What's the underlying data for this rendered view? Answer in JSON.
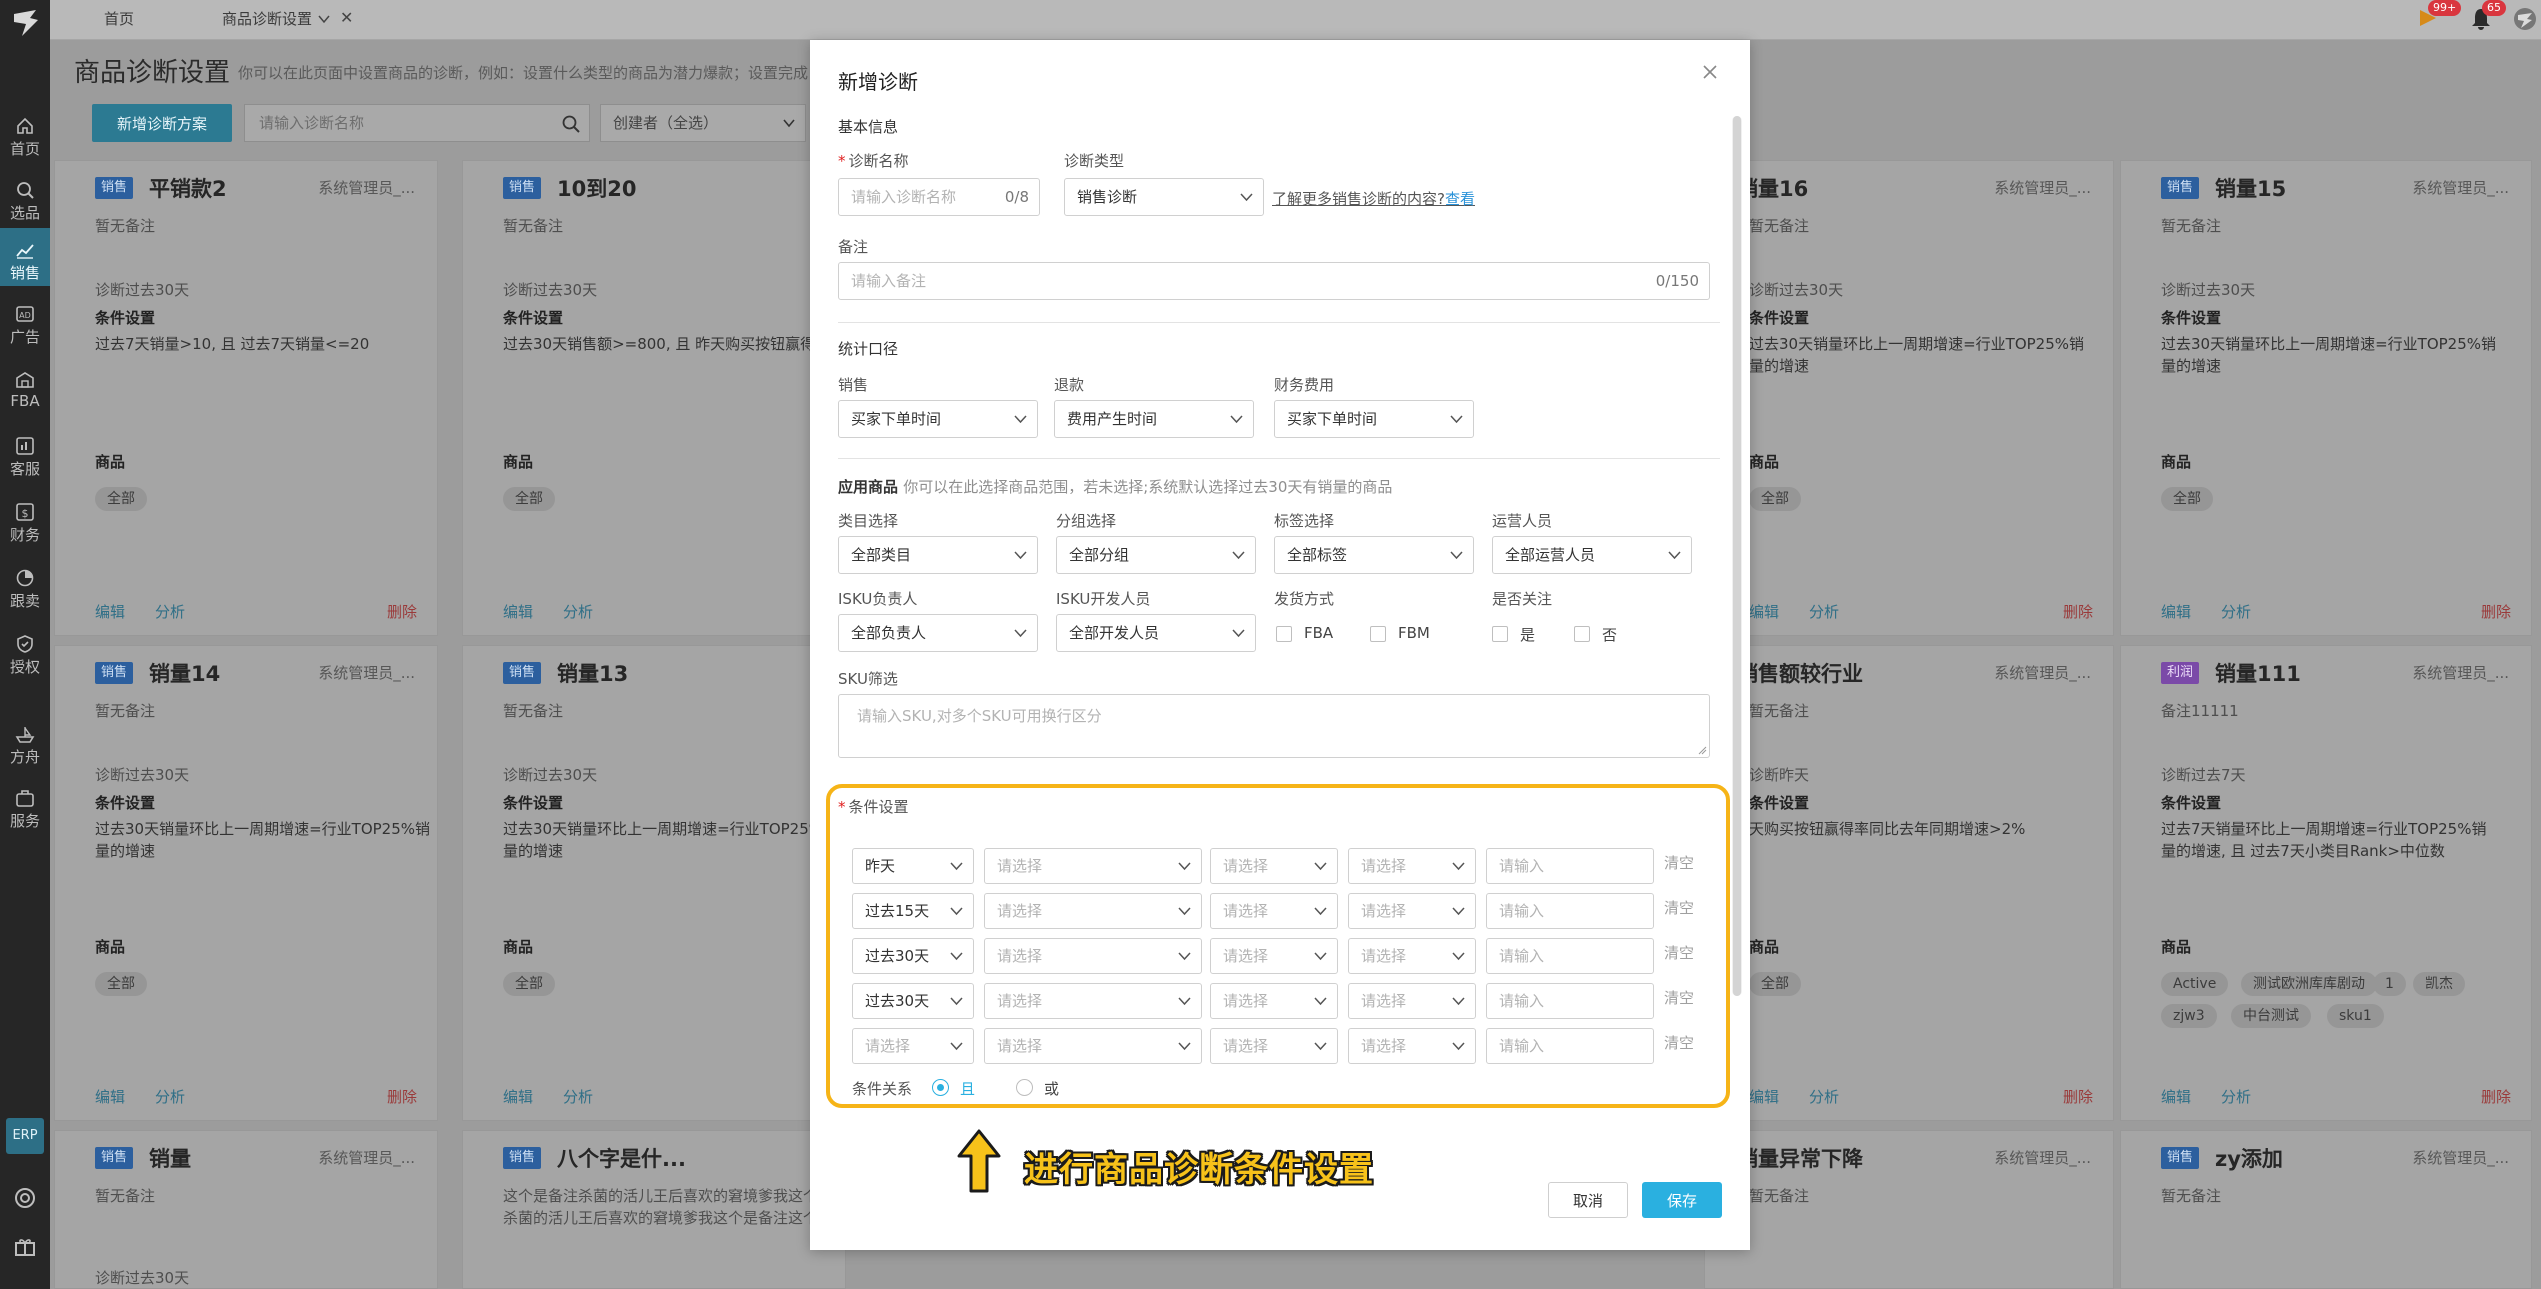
{
  "topbar": {
    "tabs": [
      {
        "label": "首页"
      },
      {
        "label": "商品诊断设置"
      }
    ],
    "notifications": {
      "flag_count": "99+",
      "bell_count": "65"
    }
  },
  "sidebar": {
    "items": [
      {
        "label": "首页",
        "icon": "home-icon"
      },
      {
        "label": "选品",
        "icon": "search-icon"
      },
      {
        "label": "销售",
        "icon": "chart-line-icon"
      },
      {
        "label": "广告",
        "icon": "ad-icon"
      },
      {
        "label": "FBA",
        "icon": "warehouse-icon"
      },
      {
        "label": "客服",
        "icon": "bar-chart-icon"
      },
      {
        "label": "财务",
        "icon": "dollar-icon"
      },
      {
        "label": "跟卖",
        "icon": "pie-chart-icon"
      },
      {
        "label": "授权",
        "icon": "shield-icon"
      },
      {
        "label": "方舟",
        "icon": "ship-icon"
      },
      {
        "label": "服务",
        "icon": "briefcase-icon"
      }
    ],
    "erp_label": "ERP",
    "active_index": 2
  },
  "page": {
    "title": "商品诊断设置",
    "desc": "你可以在此页面中设置商品的诊断，例如：设置什么类型的商品为潜力爆款；设置完成",
    "new_plan_button": "新增诊断方案",
    "search_placeholder": "请输入诊断名称",
    "creator_filter": "创建者（全选）"
  },
  "cards": [
    {
      "tag": "销售",
      "name": "平销款2",
      "owner": "系统管理员_...",
      "note": "暂无备注",
      "period": "诊断过去30天",
      "cond_label": "条件设置",
      "cond": "过去7天销量>10, 且 过去7天销量<=20",
      "prod_label": "商品",
      "chips": [
        "全部"
      ],
      "edit": "编辑",
      "analyze": "分析",
      "delete": "删除"
    },
    {
      "tag": "销售",
      "name": "10到20",
      "owner": "系统管理员_...",
      "note": "暂无备注",
      "period": "诊断过去30天",
      "cond_label": "条件设置",
      "cond": "过去30天销售额>=800, 且 昨天购买按钮赢得率",
      "prod_label": "商品",
      "chips": [
        "全部"
      ],
      "edit": "编辑",
      "analyze": "分析",
      "delete": "删除"
    },
    {
      "tag": "销售",
      "name": "销量16",
      "owner": "系统管理员_...",
      "note": "暂无备注",
      "period": "诊断过去30天",
      "cond_label": "条件设置",
      "cond": "过去30天销量环比上一周期增速=行业TOP25%销量的增速",
      "prod_label": "商品",
      "chips": [
        "全部"
      ],
      "edit": "编辑",
      "analyze": "分析",
      "delete": "删除"
    },
    {
      "tag": "销售",
      "name": "销量15",
      "owner": "系统管理员_...",
      "note": "暂无备注",
      "period": "诊断过去30天",
      "cond_label": "条件设置",
      "cond": "过去30天销量环比上一周期增速=行业TOP25%销量的增速",
      "prod_label": "商品",
      "chips": [
        "全部"
      ],
      "edit": "编辑",
      "analyze": "分析",
      "delete": "删除"
    },
    {
      "tag": "销售",
      "name": "销量14",
      "owner": "系统管理员_...",
      "note": "暂无备注",
      "period": "诊断过去30天",
      "cond_label": "条件设置",
      "cond": "过去30天销量环比上一周期增速=行业TOP25%销量的增速",
      "prod_label": "商品",
      "chips": [
        "全部"
      ],
      "edit": "编辑",
      "analyze": "分析",
      "delete": "删除"
    },
    {
      "tag": "销售",
      "name": "销量13",
      "owner": "系统管理员_...",
      "note": "暂无备注",
      "period": "诊断过去30天",
      "cond_label": "条件设置",
      "cond": "过去30天销量环比上一周期增速=行业TOP25%销量的增速",
      "prod_label": "商品",
      "chips": [
        "全部"
      ],
      "edit": "编辑",
      "analyze": "分析",
      "delete": "删除"
    },
    {
      "tag": "销售",
      "name": "销售额较行业",
      "owner": "系统管理员_...",
      "note": "暂无备注",
      "period": "诊断昨天",
      "cond_label": "条件设置",
      "cond": "天购买按钮赢得率同比去年同期增速>2%",
      "prod_label": "商品",
      "chips": [
        "全部"
      ],
      "edit": "编辑",
      "analyze": "分析",
      "delete": "删除"
    },
    {
      "tag": "利润",
      "name": "销量111",
      "owner": "系统管理员_...",
      "note": "备注11111",
      "period": "诊断过去7天",
      "cond_label": "条件设置",
      "cond": "过去7天销量环比上一周期增速=行业TOP25%销量的增速, 且 过去7天小类目Rank>中位数",
      "prod_label": "商品",
      "chips": [
        "Active",
        "测试欧洲库库剧动",
        "1",
        "凯杰",
        "zjw3",
        "中台测试",
        "sku1"
      ],
      "edit": "编辑",
      "analyze": "分析",
      "delete": "删除"
    },
    {
      "tag": "销售",
      "name": "销量",
      "owner": "系统管理员_...",
      "note": "暂无备注",
      "period": "诊断过去30天"
    },
    {
      "tag": "销售",
      "name": "八个字是什...",
      "owner": "系统管理员_...",
      "note": "这个是备注杀菌的活儿王后喜欢的窘境爹我这个",
      "note2": "杀菌的活儿王后喜欢的窘境爹我这个是备注这个"
    },
    {
      "tag": "销售",
      "name": "销量异常下降",
      "owner": "系统管理员_...",
      "note": "暂无备注"
    },
    {
      "tag": "销售",
      "name": "zy添加",
      "owner": "系统管理员_...",
      "note": "暂无备注"
    }
  ],
  "modal": {
    "title": "新增诊断",
    "basic_info": "基本信息",
    "name_label": "诊断名称",
    "name_placeholder": "请输入诊断名称",
    "name_count": "0/8",
    "type_label": "诊断类型",
    "type_value": "销售诊断",
    "learn_more": "了解更多销售诊断的内容?",
    "learn_link": "查看",
    "remark_label": "备注",
    "remark_placeholder": "请输入备注",
    "remark_count": "0/150",
    "stat_caliber": "统计口径",
    "sales_label": "销售",
    "sales_value": "买家下单时间",
    "refund_label": "退款",
    "refund_value": "费用产生时间",
    "fin_label": "财务费用",
    "fin_value": "买家下单时间",
    "apply_label": "应用商品",
    "apply_hint": "你可以在此选择商品范围，若未选择;系统默认选择过去30天有销量的商品",
    "category_label": "类目选择",
    "category_value": "全部类目",
    "group_label": "分组选择",
    "group_value": "全部分组",
    "tag_label": "标签选择",
    "tag_value": "全部标签",
    "operator_label": "运营人员",
    "operator_value": "全部运营人员",
    "isku_owner_label": "ISKU负责人",
    "isku_owner_value": "全部负责人",
    "isku_dev_label": "ISKU开发人员",
    "isku_dev_value": "全部开发人员",
    "ship_label": "发货方式",
    "ship_fba": "FBA",
    "ship_fbm": "FBM",
    "follow_label": "是否关注",
    "follow_yes": "是",
    "follow_no": "否",
    "sku_label": "SKU筛选",
    "sku_placeholder": "请输入SKU,对多个SKU可用换行区分",
    "cond_label": "条件设置",
    "cond_rows": [
      {
        "period": "昨天",
        "c1": "请选择",
        "c2": "请选择",
        "c3": "请选择",
        "input": "请输入",
        "clear": "清空"
      },
      {
        "period": "过去15天",
        "c1": "请选择",
        "c2": "请选择",
        "c3": "请选择",
        "input": "请输入",
        "clear": "清空"
      },
      {
        "period": "过去30天",
        "c1": "请选择",
        "c2": "请选择",
        "c3": "请选择",
        "input": "请输入",
        "clear": "清空"
      },
      {
        "period": "过去30天",
        "c1": "请选择",
        "c2": "请选择",
        "c3": "请选择",
        "input": "请输入",
        "clear": "清空"
      },
      {
        "period": "请选择",
        "c1": "请选择",
        "c2": "请选择",
        "c3": "请选择",
        "input": "请输入",
        "clear": "清空"
      }
    ],
    "relation_label": "条件关系",
    "relation_and": "且",
    "relation_or": "或",
    "cancel": "取消",
    "save": "保存"
  },
  "annotation": {
    "text": "进行商品诊断条件设置"
  },
  "colors": {
    "accent": "#2ab0e0",
    "highlight": "#f6b417",
    "sidebar_active": "#2d6f86"
  }
}
